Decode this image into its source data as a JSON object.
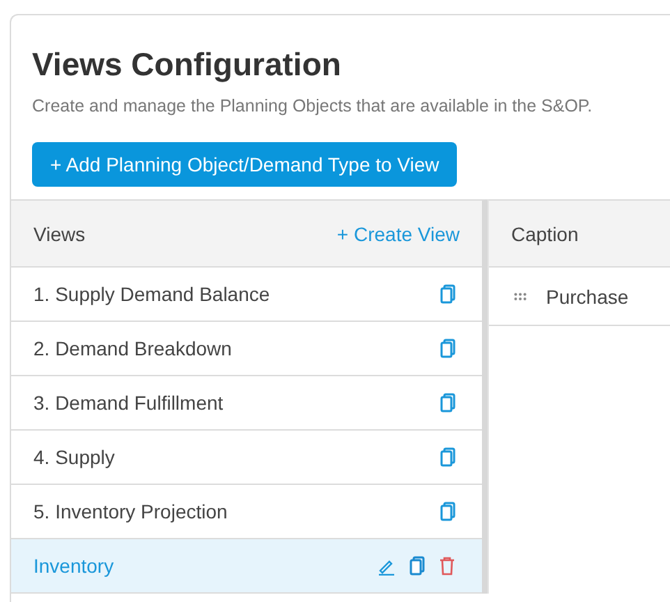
{
  "title": "Views Configuration",
  "subtitle": "Create and manage the Planning Objects that are available in the S&OP.",
  "add_button": "+ Add Planning Object/Demand Type to View",
  "views_panel": {
    "heading": "Views",
    "create_link": "+ Create View",
    "rows": [
      {
        "label": "1. Supply Demand Balance",
        "selected": false
      },
      {
        "label": "2. Demand Breakdown",
        "selected": false
      },
      {
        "label": "3. Demand Fulfillment",
        "selected": false
      },
      {
        "label": "4. Supply",
        "selected": false
      },
      {
        "label": "5. Inventory Projection",
        "selected": false
      },
      {
        "label": "Inventory",
        "selected": true
      }
    ]
  },
  "caption_panel": {
    "heading": "Caption",
    "rows": [
      {
        "label": "Purchase"
      }
    ]
  }
}
